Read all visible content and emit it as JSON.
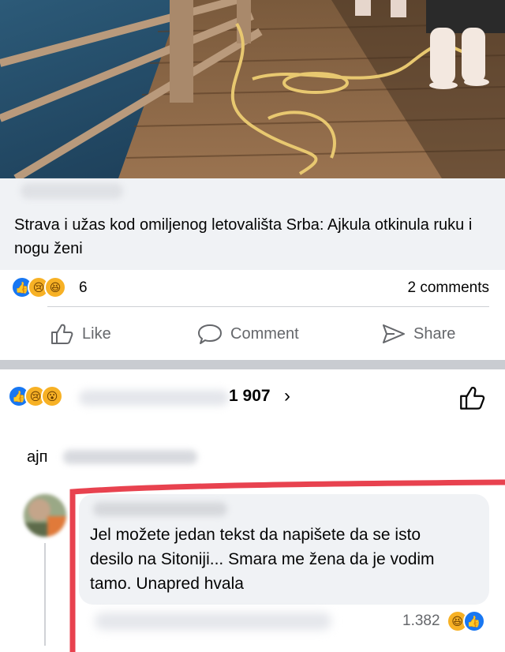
{
  "post": {
    "image_description_icon": "pier-photo-icon",
    "headline": "Strava i užas kod omiljenog letovališta Srba: Ajkula otkinula ruku i nogu ženi",
    "reaction_count": "6",
    "comments_count": "2 comments",
    "reactions": [
      "like",
      "sad",
      "haha"
    ]
  },
  "actions": {
    "like": "Like",
    "comment": "Comment",
    "share": "Share"
  },
  "comments_section": {
    "reactors_count": "1 907",
    "chevron": "›",
    "reactions": [
      "like",
      "sad",
      "wow"
    ],
    "previous_comment_text": "ајп",
    "comment": {
      "text": "Jel možete jedan tekst da napišete da se isto desilo na Sitoniji... Smara me žena da je vodim tamo. Unapred hvala",
      "reaction_count": "1.382",
      "reactions": [
        "haha",
        "like"
      ]
    }
  },
  "colors": {
    "facebook_blue": "#1877f2",
    "highlight_red": "#e8424f",
    "secondary_text": "#65676b",
    "bubble_bg": "#f0f2f5"
  }
}
